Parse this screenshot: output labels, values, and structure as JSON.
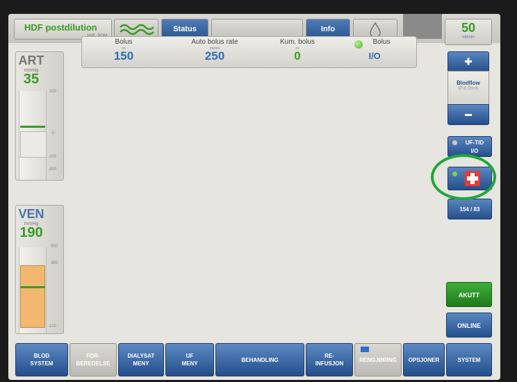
{
  "topbar": {
    "mode_title": "HDF postdilution",
    "mode_sub": "VAR. POM",
    "wave_icon": "wave-icon",
    "status_label": "Status",
    "info_label": "Info",
    "drop_icon": "drop-icon",
    "blood_rate_value": "50",
    "blood_rate_unit": "ml/min"
  },
  "art": {
    "label": "ART",
    "unit": "mmHg",
    "value": "35",
    "ticks": [
      "300",
      "-5",
      "-205",
      "-300"
    ]
  },
  "ven": {
    "label": "VEN",
    "unit": "mmHg",
    "value": "190",
    "ticks": [
      "500",
      "385",
      "-100"
    ]
  },
  "bolus_panel": {
    "bolus_label": "Bolus",
    "bolus_unit": "ml",
    "bolus_value": "150",
    "auto_label": "Auto bolus rate",
    "auto_unit": "ml/min",
    "auto_value": "250",
    "kum_label": "Kum. bolus",
    "kum_unit": "ml",
    "kum_value": "0",
    "bolus2_label": "Bolus",
    "bolus2_value": "I/O"
  },
  "right": {
    "plus_icon": "plus-icon",
    "bloodflow_label": "Blodflow",
    "bloodflow_sub": "Ø 8,0mm",
    "minus_icon": "minus-icon",
    "uf_tid_label": "UF-TID",
    "uf_tid_value": "I/O",
    "first_aid_icon": "first-aid-cross-icon",
    "bp_value": "154 / 83",
    "akutt_label": "AKUTT",
    "online_label": "ONLINE"
  },
  "bottom": [
    [
      "BLOD",
      "SYSTEM"
    ],
    [
      "FOR-",
      "BEREDELSE"
    ],
    [
      "DIALYSAT",
      "MENY"
    ],
    [
      "UF",
      "MENY"
    ],
    [
      "BEHANDLING"
    ],
    [
      "RE-",
      "INFUSJON"
    ],
    [
      "RENGJØRING"
    ],
    [
      "OPSJONER"
    ],
    [
      "SYSTEM"
    ]
  ],
  "colors": {
    "accent_green": "#3a9a28",
    "button_blue": "#2a5490",
    "highlight_circle": "#1fa83a",
    "orange_bar": "#f2b86f"
  }
}
